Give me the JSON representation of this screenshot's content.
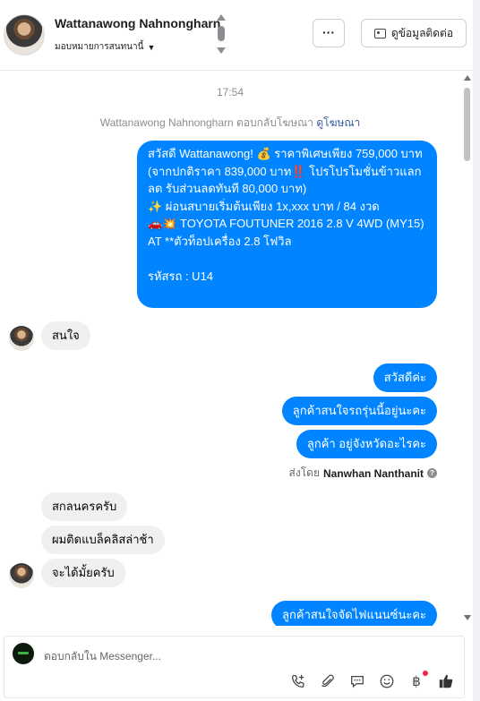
{
  "header": {
    "name": "Wattanawong Nahnongharn",
    "assign_label": "มอบหมายการสนทนานี้",
    "more_label": "···",
    "contact_button": "ดูข้อมูลติดต่อ"
  },
  "thread": {
    "timestamp": "17:54",
    "ad_reply_text": "Wattanawong Nahnongharn ตอบกลับโฆษณา",
    "ad_link": "ดูโฆษณา",
    "ad_message": "สวัสดี Wattanawong! 💰 ราคาพิเศษเพียง 759,000 บาท\n(จากปกติราคา 839,000 บาท‼️ โปรโปรโมชั่นข้าวแลกลด รับส่วนลดทันที 80,000 บาท)\n✨ ผ่อนสบายเริ่มต้นเพียง 1x,xxx บาท / 84 งวด\n🚗💥 TOYOTA FOUTUNER 2016 2.8 V 4WD (MY15) AT **ตัวท็อปเครื่อง 2.8 โฟวิล\n\nรหัสรถ : U14",
    "msg_in_1": "สนใจ",
    "msg_out_1": "สวัสดีค่ะ",
    "msg_out_2": "ลูกค้าสนใจรถรุ่นนี้อยู่นะคะ",
    "msg_out_3": "ลูกค้า อยู่จังหวัดอะไรคะ",
    "sent_by_label": "ส่งโดย",
    "sent_by_name": "Nanwhan Nanthanit",
    "msg_in_2": "สกลนครครับ",
    "msg_in_3": "ผมติดแบล็คลิสล่าช้า",
    "msg_in_4": "จะได้มั้ยครับ",
    "msg_out_4": "ลูกค้าสนใจจัดไฟแนนซ์นะคะ"
  },
  "composer": {
    "placeholder": "ตอบกลับใน Messenger..."
  },
  "colors": {
    "brand_blue": "#0084ff",
    "incoming_bubble": "#f0f0f0",
    "notification_dot": "#f02849"
  },
  "icons": [
    "phone-add-icon",
    "paperclip-icon",
    "chat-bubble-icon",
    "emoji-icon",
    "baht-icon",
    "thumbs-up-icon"
  ]
}
